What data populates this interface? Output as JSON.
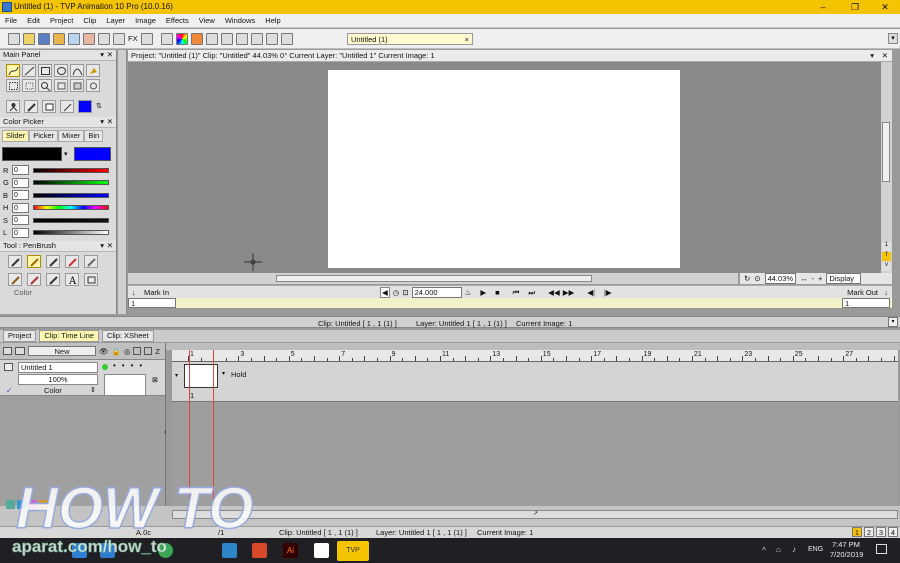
{
  "window": {
    "title": "Untitled (1) - TVP Animation 10 Pro (10.0.16)",
    "minimize": "–",
    "maximize": "❐",
    "close": "✕"
  },
  "menu": [
    "File",
    "Edit",
    "Project",
    "Clip",
    "Layer",
    "Image",
    "Effects",
    "View",
    "Windows",
    "Help"
  ],
  "toolbar": {
    "fx_label": "FX",
    "doc_tab": "Untitled (1)",
    "doc_tab_close": "×"
  },
  "main_panel": {
    "title": "Main Panel"
  },
  "color_picker": {
    "title": "Color Picker",
    "tabs": [
      "Slider",
      "Picker",
      "Mixer",
      "Bin"
    ],
    "active_tab": "Slider",
    "primary_color": "#000000",
    "secondary_color": "#0000ff",
    "sliders": [
      {
        "label": "R",
        "value": "0"
      },
      {
        "label": "G",
        "value": "0"
      },
      {
        "label": "B",
        "value": "0"
      },
      {
        "label": "H",
        "value": "0"
      },
      {
        "label": "S",
        "value": "0"
      },
      {
        "label": "L",
        "value": "0"
      }
    ]
  },
  "tool_panel": {
    "title": "Tool : PenBrush",
    "cutoff_label": "Color"
  },
  "project_bar": {
    "text": "Project: \"Untitled (1)\"  Clip: \"Untitled\"   44.03%   0°  Current Layer: \"Untitled 1\"  Current Image: 1"
  },
  "canvas_side": {
    "s1": "1",
    "s2": "f",
    "s3": "v"
  },
  "zoom": {
    "value": "44.03%",
    "display_label": "Display",
    "minus": "-",
    "plus": "+"
  },
  "playback": {
    "mark_in_label": "Mark In",
    "mark_out_label": "Mark Out",
    "fps": "24.000",
    "mark_in_value": "1",
    "mark_out_value": "1"
  },
  "clip_status": {
    "clip": "Clip: Untitled [ 1 , 1  (1) ]",
    "layer": "Layer: Untitled 1 [ 1 , 1  (1) ]",
    "image": "Current Image: 1"
  },
  "bottom_tabs": [
    "Project",
    "Clip: Time Line",
    "Clip: XSheet"
  ],
  "active_bottom_tab": "Clip: Time Line",
  "timeline": {
    "new_button": "New",
    "layer_name": "Untitled 1",
    "opacity": "100%",
    "blend_mode": "Color",
    "hold_label": "Hold",
    "frame_number": "1",
    "ruler": [
      "1",
      "3",
      "5",
      "7",
      "9",
      "11",
      "13",
      "15",
      "17",
      "19",
      "21",
      "23",
      "25",
      "27"
    ]
  },
  "status_bar": {
    "clip": "Clip: Untitled [ 1 , 1  (1) ]",
    "layer": "Layer: Untitled 1 [ 1 , 1  (1) ]",
    "image": "Current Image: 1",
    "pages": [
      "1",
      "2",
      "3",
      "4"
    ],
    "left_fragment": "A.0c",
    "left_fragment2": "/1"
  },
  "taskbar": {
    "time": "7:47 PM",
    "date": "7/20/2019",
    "lang": "ENG"
  },
  "watermark": {
    "line1": "HOW TO",
    "line2": "aparat.com/how_to"
  }
}
